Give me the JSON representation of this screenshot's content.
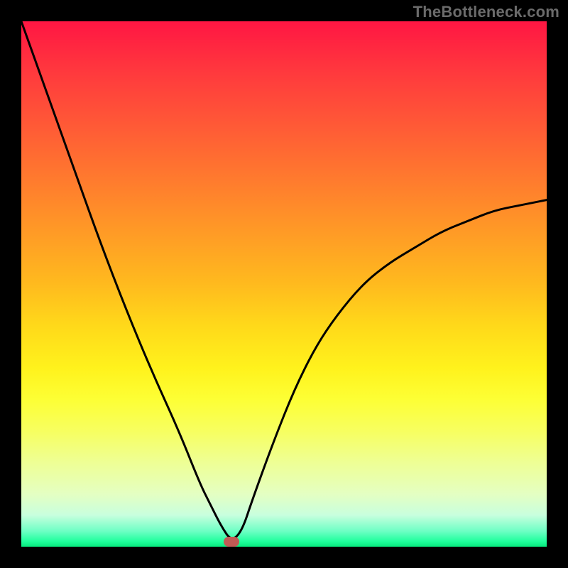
{
  "watermark": "TheBottleneck.com",
  "chart_data": {
    "type": "line",
    "title": "",
    "xlabel": "",
    "ylabel": "",
    "xlim": [
      0,
      100
    ],
    "ylim": [
      0,
      100
    ],
    "grid": false,
    "legend": false,
    "annotations": [],
    "gradient_background": {
      "orientation": "vertical",
      "stops": [
        {
          "pos": 0,
          "color": "#ff1643"
        },
        {
          "pos": 50,
          "color": "#ffba1e"
        },
        {
          "pos": 72,
          "color": "#fdff35"
        },
        {
          "pos": 100,
          "color": "#07e97e"
        }
      ]
    },
    "series": [
      {
        "name": "bottleneck-curve",
        "color": "#000000",
        "x": [
          0,
          5,
          10,
          15,
          20,
          25,
          30,
          34,
          36,
          38,
          40,
          42,
          44,
          48,
          52,
          56,
          60,
          65,
          70,
          75,
          80,
          85,
          90,
          95,
          100
        ],
        "values": [
          100,
          86,
          72,
          58,
          45,
          33,
          22,
          12,
          8,
          4,
          1,
          3,
          9,
          20,
          30,
          38,
          44,
          50,
          54,
          57,
          60,
          62,
          64,
          65,
          66
        ]
      }
    ],
    "marker": {
      "name": "optimal-point",
      "x": 40,
      "y": 1,
      "color": "#c05a55"
    }
  }
}
